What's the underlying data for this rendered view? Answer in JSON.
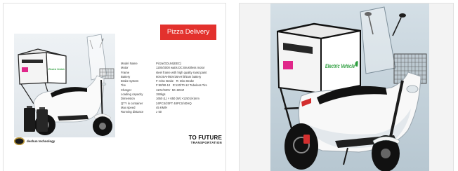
{
  "colors": {
    "accent": "#e3312d",
    "box_label_green": "#2e9e3f",
    "tail_light_pink": "#e0278a",
    "brake_red": "#d32f2f"
  },
  "catalog_page": {
    "banner": "Pizza Delivery",
    "photo_box_label": "Electric Vehicle",
    "specs": [
      {
        "label": "Model Name",
        "value": "Pizza/GDL94(EEC)"
      },
      {
        "label": "Motor",
        "value": "1200/2000 watts DC Brushless motor"
      },
      {
        "label": "Frame",
        "value": "steel frame with high quality roast paint"
      },
      {
        "label": "Battery",
        "value": "60V20AH/60V26AH lithium battery"
      },
      {
        "label": "Brake system",
        "value": "F: Disc Brake   R: Disc Brake"
      },
      {
        "label": "Tire",
        "value": "F:90/90-12   R:120/70-12 Tubeless Tire"
      },
      {
        "label": "Charger",
        "value": "110V/220V  50~60HZ"
      },
      {
        "label": "Loading capacity",
        "value": "150kgs"
      },
      {
        "label": "Dimension",
        "value": "1650 (L) × 650 (W) ×1150 (H)mm"
      },
      {
        "label": "QTY in container",
        "value": "24PCS/20FT 48PCS/40HQ"
      },
      {
        "label": "Max speed",
        "value": "45 KM/H"
      },
      {
        "label": "Running distance",
        "value": "≥ 50"
      }
    ],
    "brand_name": "deshun technology",
    "slogan": {
      "line1": "TO FUTURE",
      "line2": "TRANSPORTATION"
    }
  },
  "product_photo": {
    "box_label": "Electric Vehicle"
  }
}
